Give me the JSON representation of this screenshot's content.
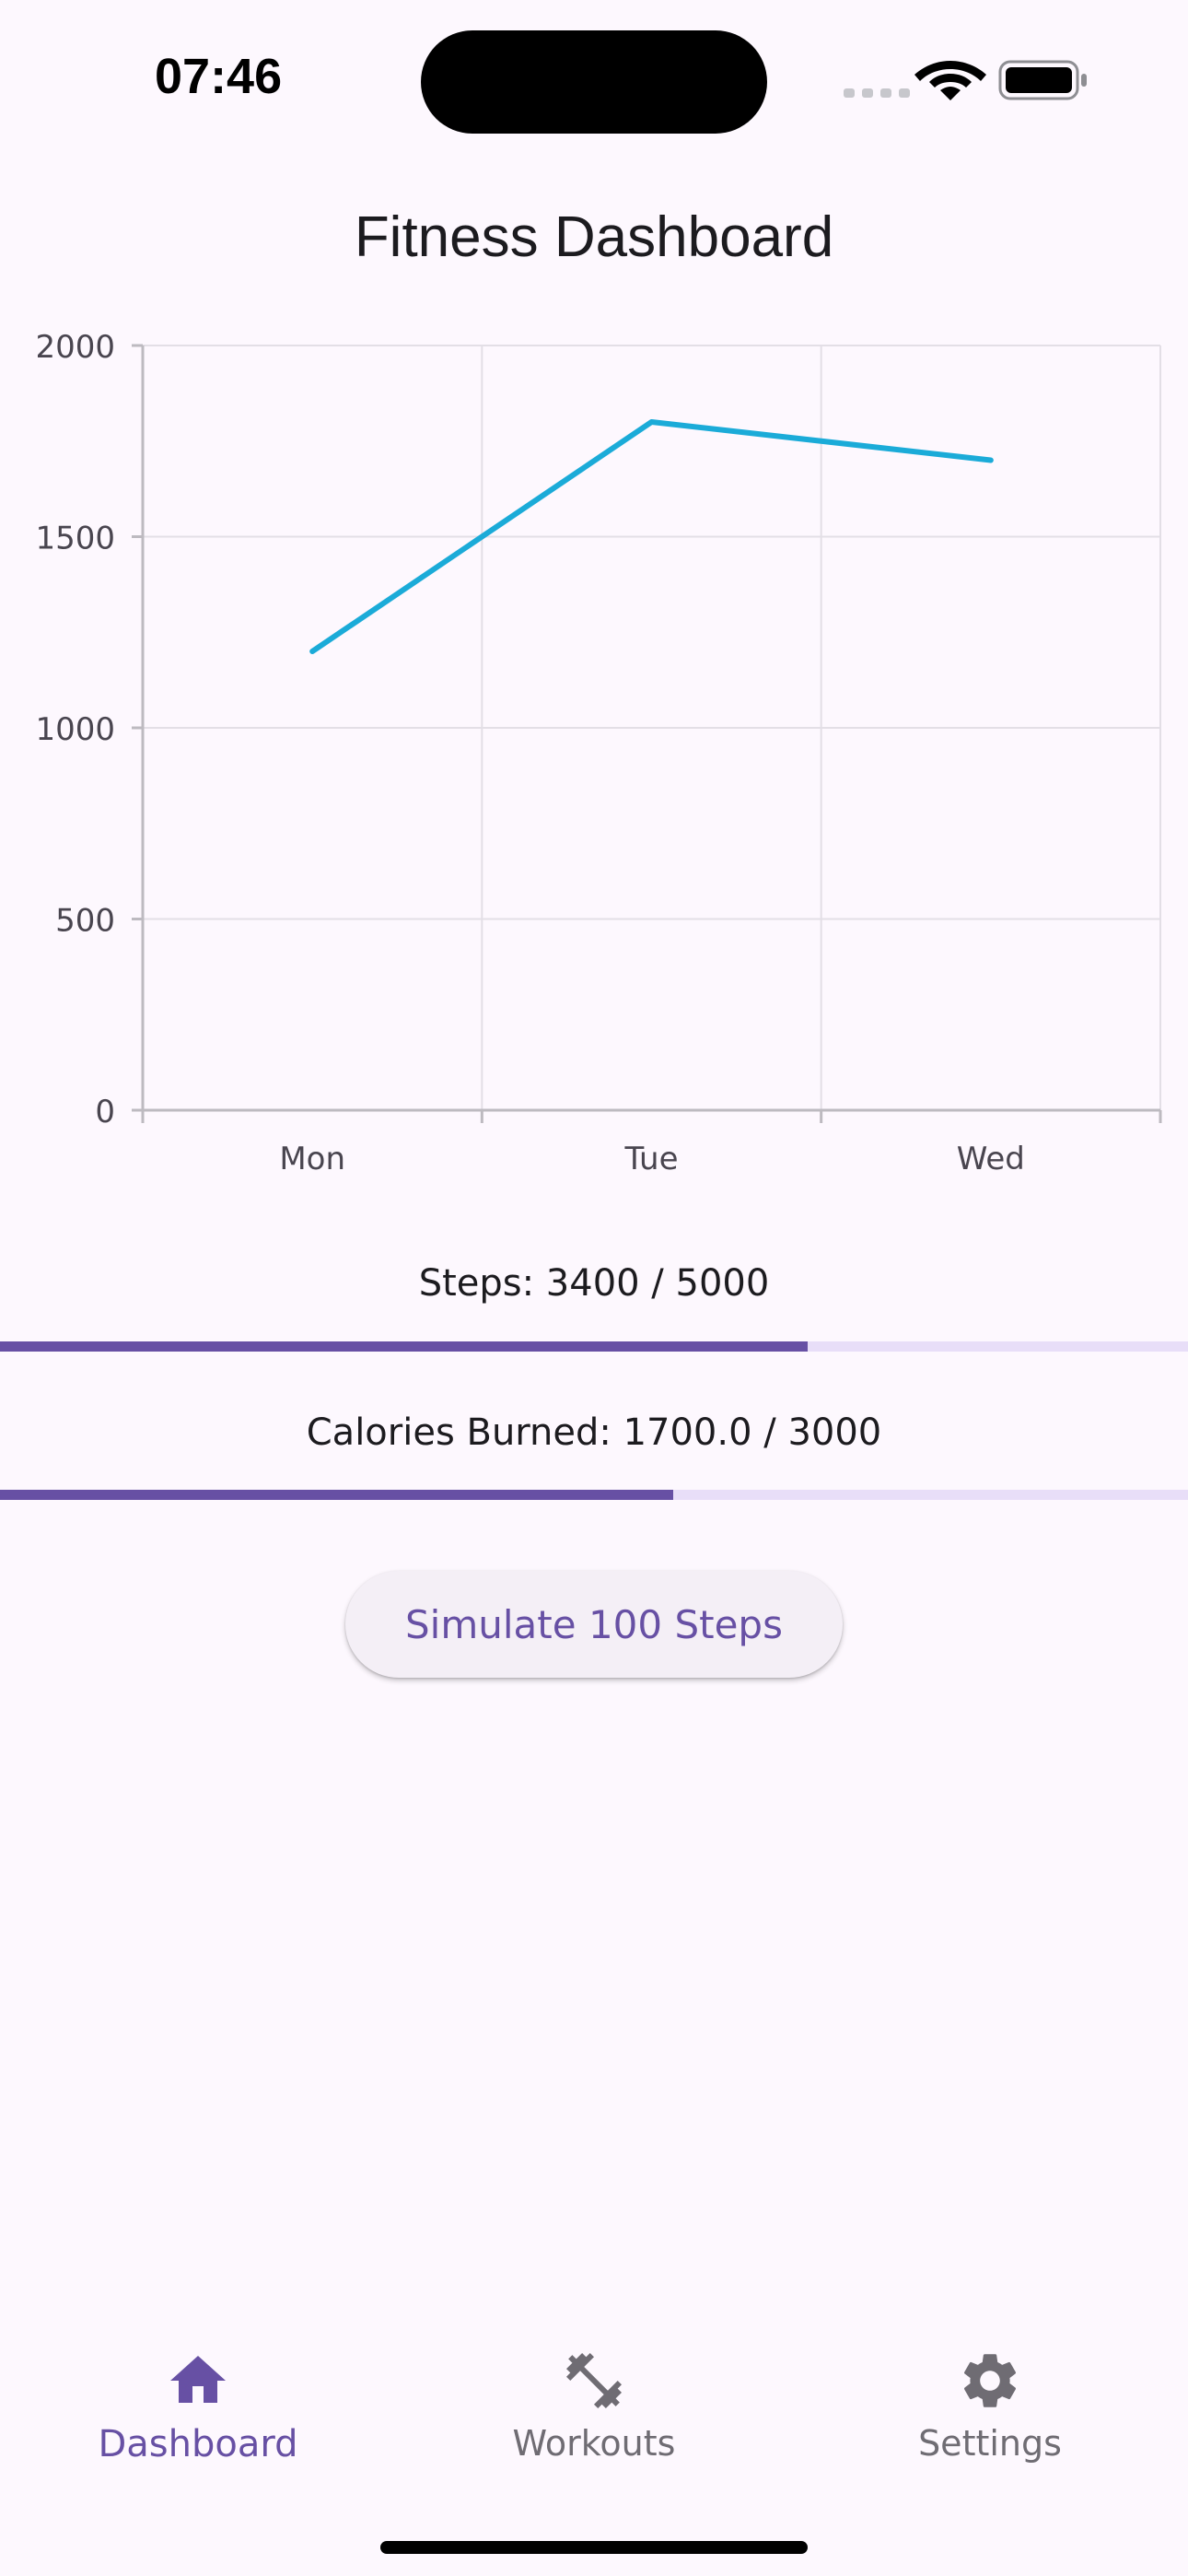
{
  "status_bar": {
    "time": "07:46"
  },
  "page": {
    "title": "Fitness Dashboard"
  },
  "chart_data": {
    "type": "line",
    "categories": [
      "Mon",
      "Tue",
      "Wed"
    ],
    "series": [
      {
        "values": [
          1200,
          1800,
          1700
        ],
        "color": "#1BABD8"
      }
    ],
    "ylim": [
      0,
      2000
    ],
    "yticks": [
      0,
      500,
      1000,
      1500,
      2000
    ],
    "grid": true,
    "title": "",
    "xlabel": "",
    "ylabel": ""
  },
  "steps": {
    "label": "Steps: 3400 / 5000",
    "current": 3400,
    "goal": 5000
  },
  "calories": {
    "label": "Calories Burned: 1700.0 / 3000",
    "current": 1700.0,
    "goal": 3000
  },
  "actions": {
    "simulate_label": "Simulate 100 Steps"
  },
  "nav": {
    "items": [
      {
        "label": "Dashboard",
        "icon": "home-icon",
        "active": true
      },
      {
        "label": "Workouts",
        "icon": "dumbbell-icon",
        "active": false
      },
      {
        "label": "Settings",
        "icon": "gear-icon",
        "active": false
      }
    ]
  },
  "colors": {
    "accent": "#6750A4",
    "track": "#E8DEF8",
    "line": "#1BABD8",
    "inactive": "#6F6C73"
  }
}
